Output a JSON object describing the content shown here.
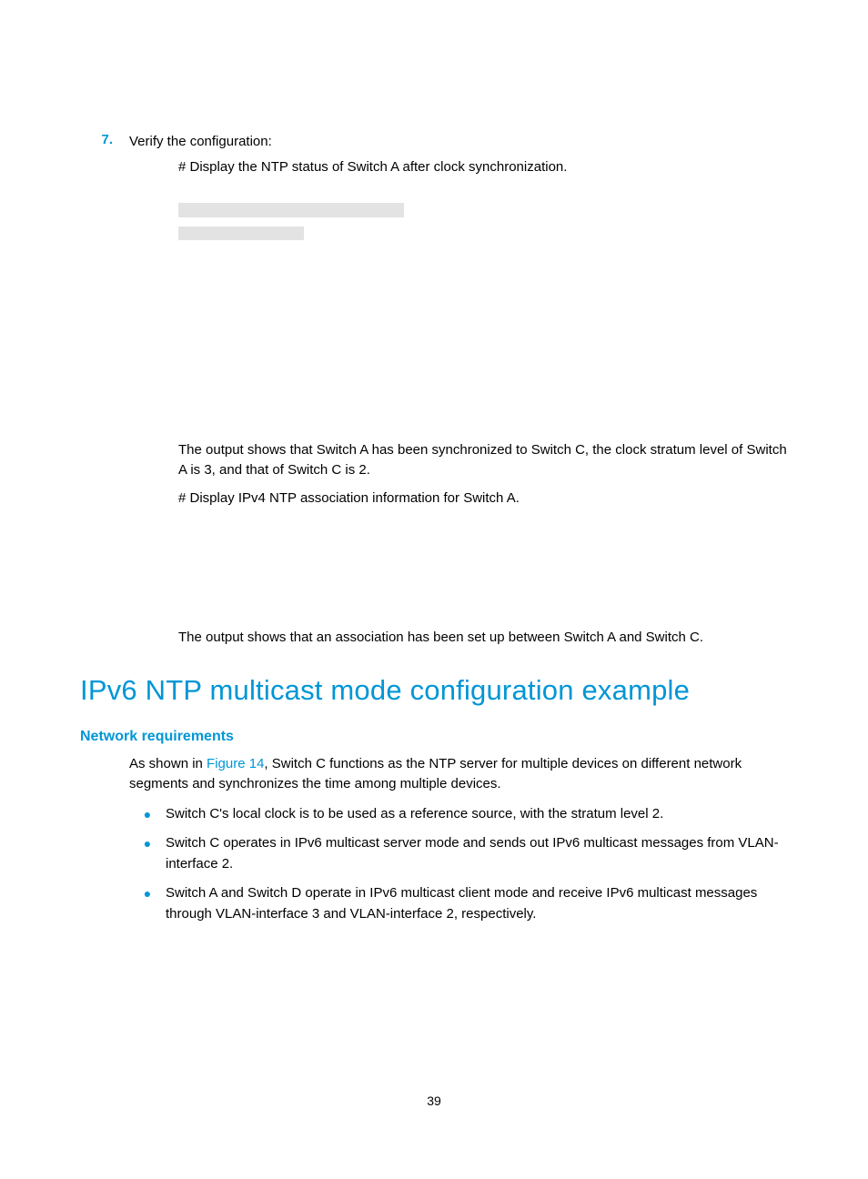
{
  "step": {
    "num": "7.",
    "text": "Verify the configuration:"
  },
  "hash1": "# Display the NTP status of Switch A after clock synchronization.",
  "para1": "The output shows that Switch A has been synchronized to Switch C, the clock stratum level of Switch A is 3, and that of Switch C is 2.",
  "hash2": "# Display IPv4 NTP association information for Switch A.",
  "para2": "The output shows that an association has been set up between Switch A and Switch C.",
  "heading1": "IPv6 NTP multicast mode configuration example",
  "heading2": "Network requirements",
  "intro_prefix": "As shown in ",
  "figref": "Figure 14",
  "intro_suffix": ", Switch C functions as the NTP server for multiple devices on different network segments and synchronizes the time among multiple devices.",
  "bullets": [
    "Switch C's local clock is to be used as a reference source, with the stratum level 2.",
    "Switch C operates in IPv6 multicast server mode and sends out IPv6 multicast messages from VLAN-interface 2.",
    "Switch A and Switch D operate in IPv6 multicast client mode and receive IPv6 multicast messages through VLAN-interface 3 and VLAN-interface 2, respectively."
  ],
  "pagenum": "39"
}
